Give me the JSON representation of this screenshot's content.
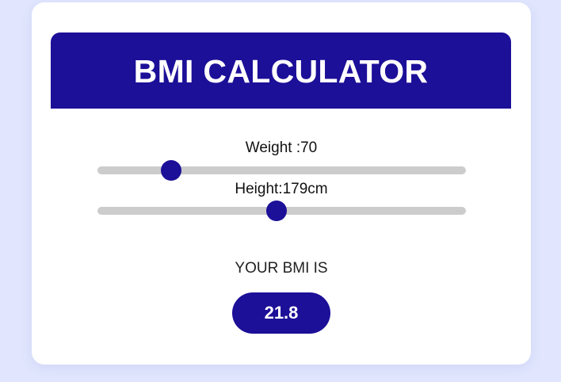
{
  "header": {
    "title": "BMI CALCULATOR"
  },
  "weight": {
    "label": "Weight :70",
    "value": 70,
    "slider_fraction": 0.2
  },
  "height": {
    "label": "Height:179cm",
    "value": 179,
    "slider_fraction": 0.487
  },
  "result": {
    "label": "YOUR BMI IS",
    "value": "21.8"
  },
  "colors": {
    "accent": "#1c0f98",
    "background": "#e1e6fe",
    "track": "#cccccc"
  }
}
